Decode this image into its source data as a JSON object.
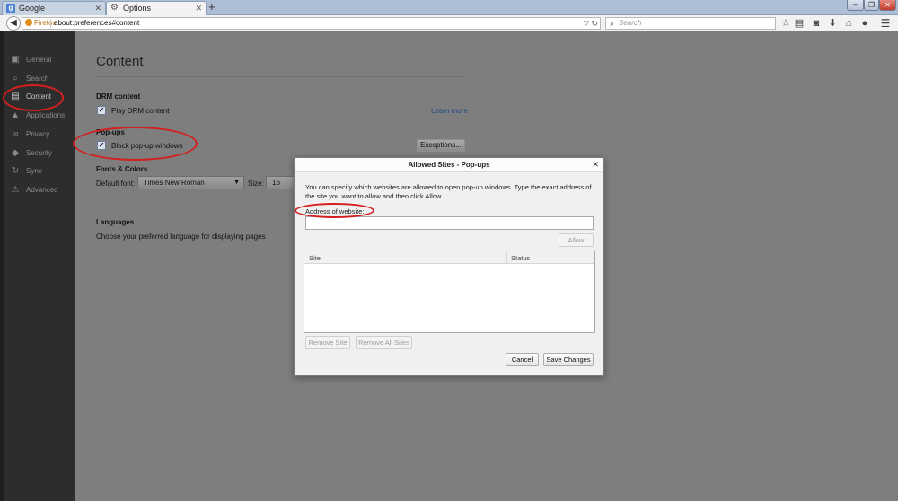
{
  "browser": {
    "tabs": [
      {
        "title": "Google",
        "favicon": "google-favicon"
      },
      {
        "title": "Options",
        "favicon": "gear-icon"
      }
    ],
    "new_tab_symbol": "+",
    "window_controls": {
      "minimize": "–",
      "restore": "❐",
      "close": "✕"
    },
    "identity_label": "Firefox",
    "url": "about:preferences#content",
    "search_placeholder": "Search",
    "toolbar_icons": [
      "star-icon",
      "clipboard-icon",
      "pocket-icon",
      "download-icon",
      "home-icon",
      "chat-icon",
      "menu-icon"
    ]
  },
  "sidebar": {
    "items": [
      {
        "label": "General",
        "icon": "general-icon",
        "glyph": "▣"
      },
      {
        "label": "Search",
        "icon": "search-icon",
        "glyph": "⌕"
      },
      {
        "label": "Content",
        "icon": "content-icon",
        "glyph": "▤"
      },
      {
        "label": "Applications",
        "icon": "applications-icon",
        "glyph": "▲"
      },
      {
        "label": "Privacy",
        "icon": "privacy-icon",
        "glyph": "∞"
      },
      {
        "label": "Security",
        "icon": "security-icon",
        "glyph": "◆"
      },
      {
        "label": "Sync",
        "icon": "sync-icon",
        "glyph": "↻"
      },
      {
        "label": "Advanced",
        "icon": "advanced-icon",
        "glyph": "⚠"
      }
    ],
    "selected": "Content"
  },
  "main": {
    "title": "Content",
    "drm": {
      "heading": "DRM content",
      "checkbox_label": "Play DRM content",
      "checked": true,
      "learn_more": "Learn more"
    },
    "popups": {
      "heading": "Pop-ups",
      "checkbox_label": "Block pop-up windows",
      "checked": true,
      "exceptions_button": "Exceptions..."
    },
    "fonts": {
      "heading": "Fonts & Colors",
      "default_font_label": "Default font:",
      "default_font_value": "Times New Roman",
      "size_label": "Size:",
      "size_value": "16"
    },
    "languages": {
      "heading": "Languages",
      "description": "Choose your preferred language for displaying pages"
    }
  },
  "dialog": {
    "title": "Allowed Sites - Pop-ups",
    "description": "You can specify which websites are allowed to open pop-up windows. Type the exact address of the site you want to allow and then click Allow.",
    "address_label": "Address of website:",
    "address_value": "",
    "allow_button": "Allow",
    "columns": [
      "Site",
      "Status"
    ],
    "rows": [],
    "remove_site_button": "Remove Site",
    "remove_all_button": "Remove All Sites",
    "cancel_button": "Cancel",
    "save_button": "Save Changes"
  },
  "colors": {
    "annotation": "#d41f1f",
    "sidebar_bg": "#2d2d2d",
    "overlay_bg": "#7e7e7e"
  }
}
